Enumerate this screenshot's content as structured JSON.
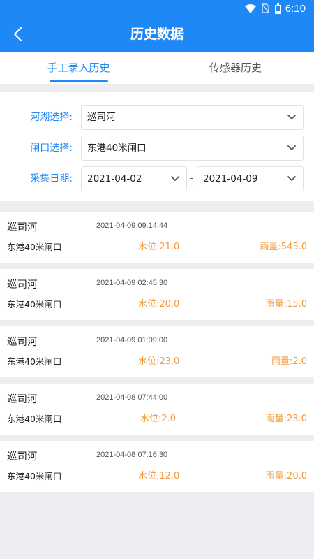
{
  "status_bar": {
    "time": "6:10",
    "wifi_icon": "wifi-icon",
    "signal_icon": "no-sim-icon",
    "battery_icon": "battery-icon"
  },
  "header": {
    "title": "历史数据",
    "back_icon": "chevron-left-icon"
  },
  "tabs": [
    {
      "label": "手工录入历史",
      "active": true
    },
    {
      "label": "传感器历史",
      "active": false
    }
  ],
  "filters": {
    "river_label": "河湖选择:",
    "river_value": "巡司河",
    "gate_label": "闸口选择:",
    "gate_value": "东港40米闸口",
    "date_label": "采集日期:",
    "date_start": "2021-04-02",
    "date_separator": "-",
    "date_end": "2021-04-09"
  },
  "records": [
    {
      "river": "巡司河",
      "time": "2021-04-09 09:14:44",
      "gate": "东港40米闸口",
      "water": "水位:21.0",
      "rain": "雨量:545.0"
    },
    {
      "river": "巡司河",
      "time": "2021-04-09 02:45:30",
      "gate": "东港40米闸口",
      "water": "水位:20.0",
      "rain": "雨量:15.0"
    },
    {
      "river": "巡司河",
      "time": "2021-04-09 01:09:00",
      "gate": "东港40米闸口",
      "water": "水位:23.0",
      "rain": "雨量:2.0"
    },
    {
      "river": "巡司河",
      "time": "2021-04-08 07:44:00",
      "gate": "东港40米闸口",
      "water": "水位:2.0",
      "rain": "雨量:23.0"
    },
    {
      "river": "巡司河",
      "time": "2021-04-08 07:16:30",
      "gate": "东港40米闸口",
      "water": "水位:12.0",
      "rain": "雨量:20.0"
    }
  ],
  "colors": {
    "primary": "#1e88f7",
    "accent": "#f39a3a",
    "background": "#eeeef2"
  }
}
